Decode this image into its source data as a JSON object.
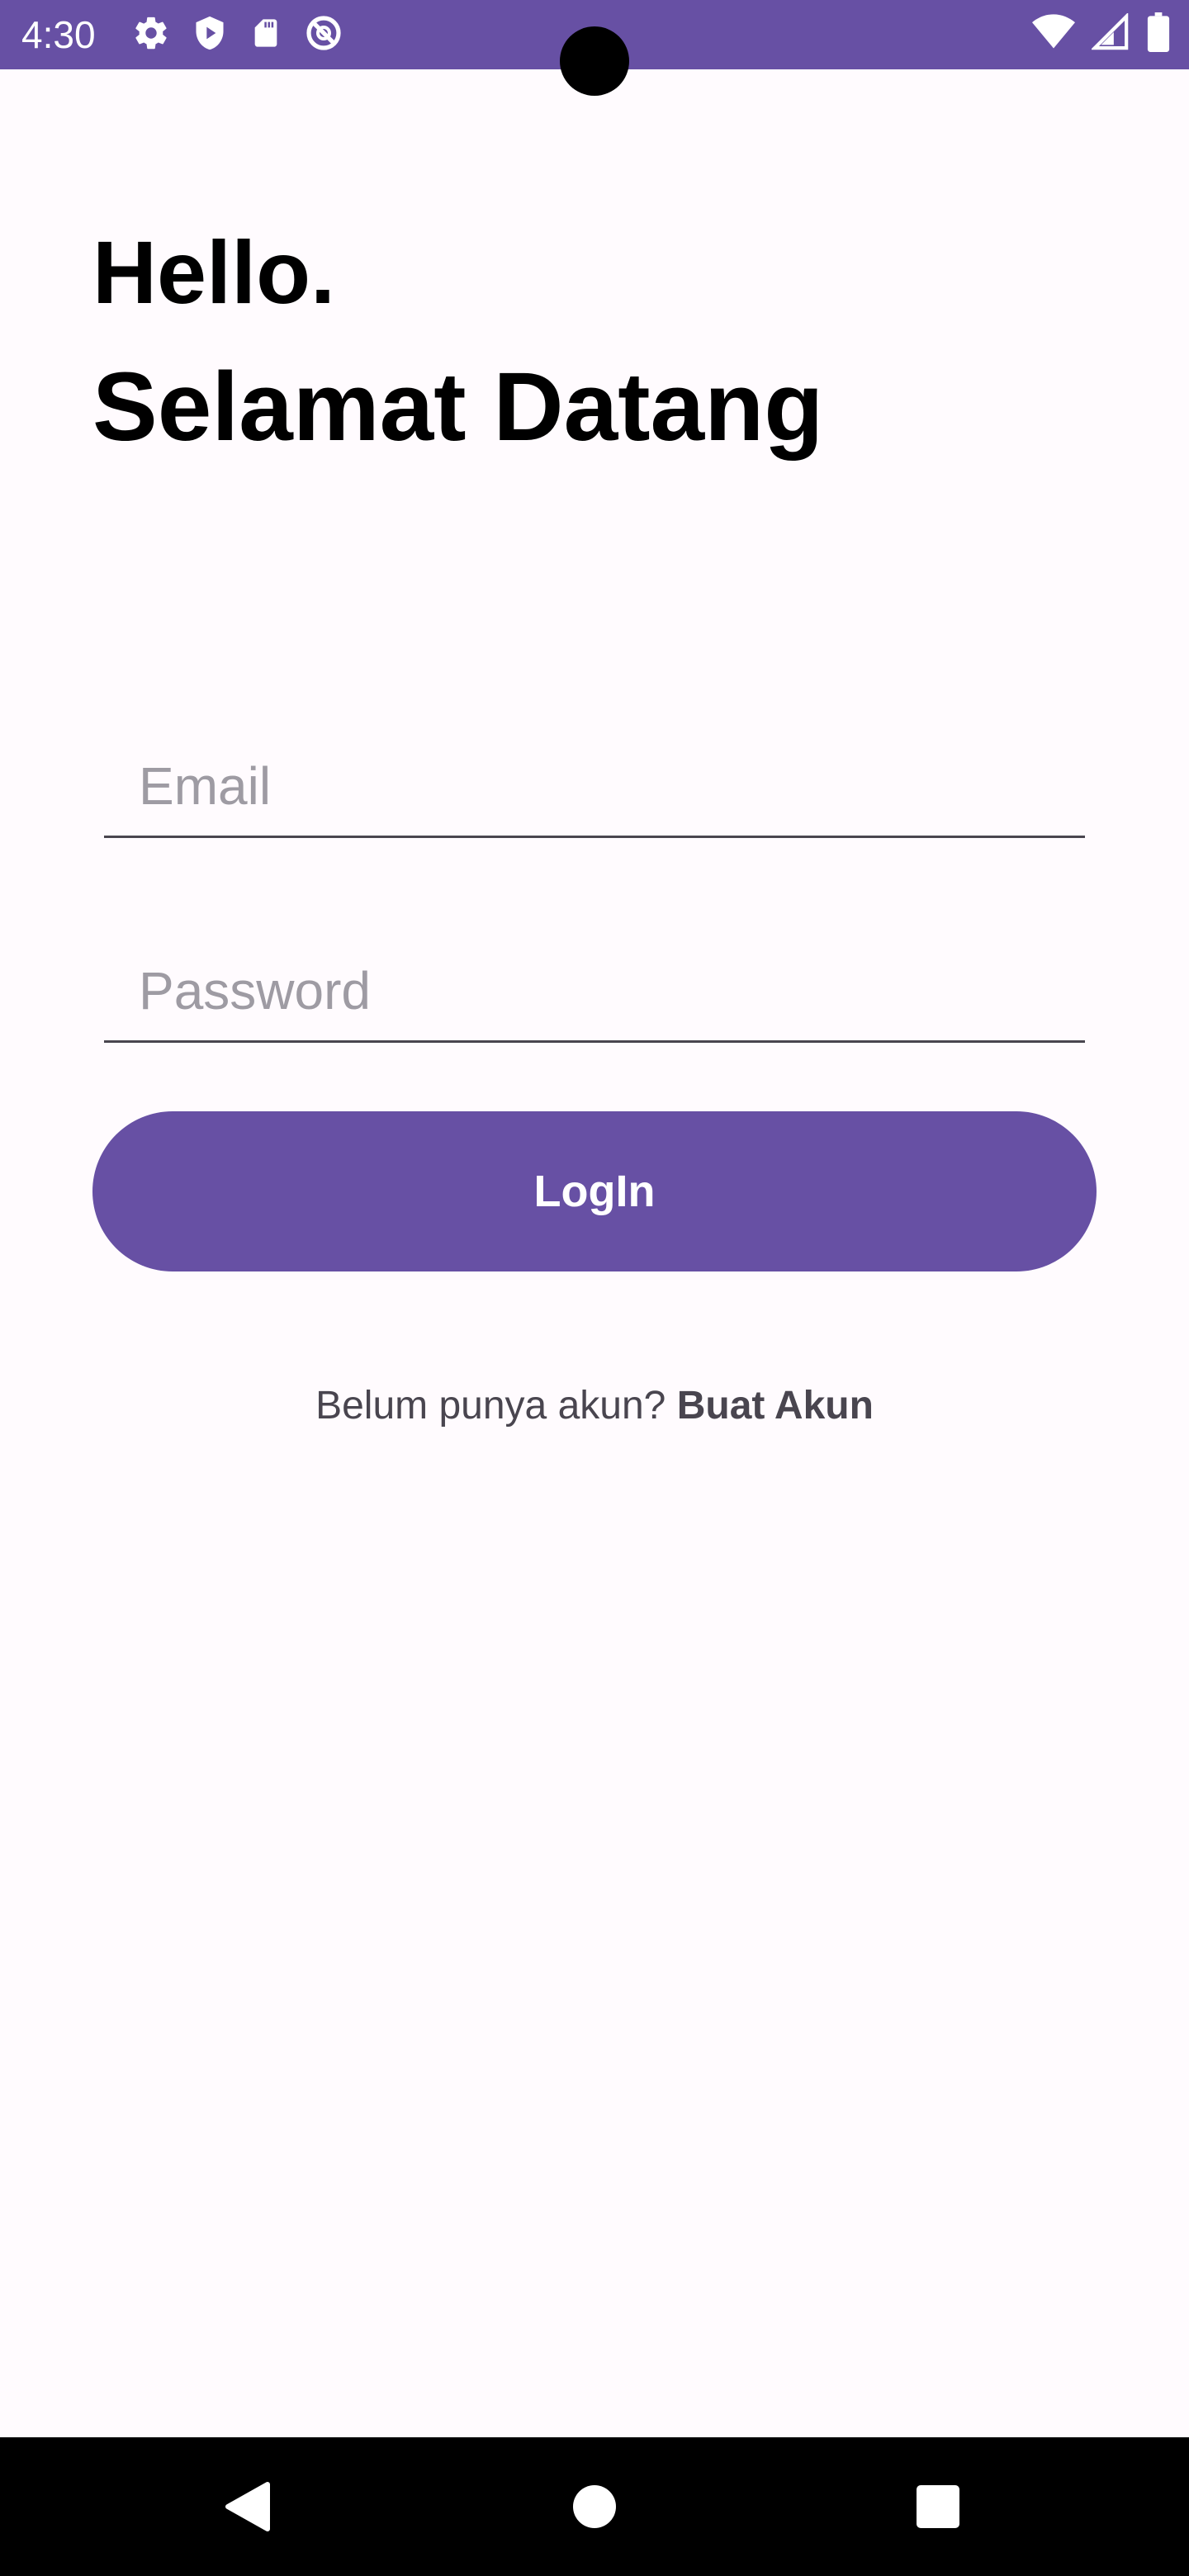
{
  "status_bar": {
    "time": "4:30",
    "bg_color": "#6750a4",
    "left_icons": [
      "settings-icon",
      "shield-play-icon",
      "sd-card-icon",
      "do-not-disturb-icon"
    ],
    "right_icons": [
      "wifi-icon",
      "signal-icon",
      "battery-icon"
    ]
  },
  "greeting": {
    "line1": "Hello.",
    "line2": "Selamat Datang"
  },
  "form": {
    "email_placeholder": "Email",
    "email_value": "",
    "password_placeholder": "Password",
    "password_value": "",
    "login_label": "LogIn"
  },
  "register": {
    "prompt": "Belum punya akun? ",
    "link_label": "Buat Akun"
  },
  "nav_bar": {
    "buttons": [
      "back-icon",
      "home-icon",
      "recents-icon"
    ]
  },
  "colors": {
    "accent": "#6750a4",
    "background": "#fffbfe",
    "text_secondary": "#49454f"
  }
}
